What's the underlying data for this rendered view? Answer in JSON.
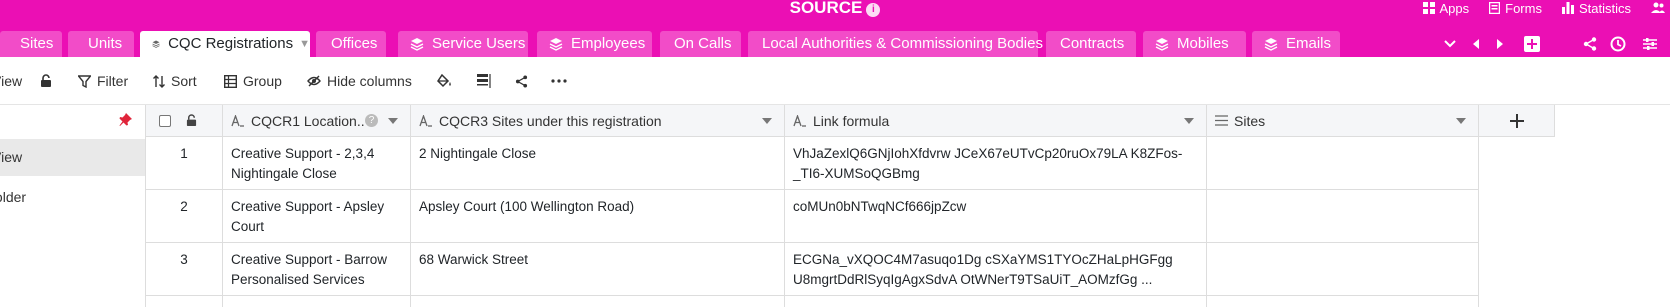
{
  "header": {
    "title": "SOURCE",
    "links": [
      {
        "label": "Apps",
        "icon": "apps-icon"
      },
      {
        "label": "Forms",
        "icon": "forms-icon"
      },
      {
        "label": "Statistics",
        "icon": "statistics-icon"
      }
    ]
  },
  "tabs": [
    {
      "label": "Sites",
      "icon": ""
    },
    {
      "label": "Units",
      "icon": ""
    },
    {
      "label": "CQC Registrations",
      "icon": "layers-icon",
      "active": true
    },
    {
      "label": "Offices",
      "icon": ""
    },
    {
      "label": "Service Users",
      "icon": "layers-icon"
    },
    {
      "label": "Employees",
      "icon": "layers-icon"
    },
    {
      "label": "On Calls",
      "icon": ""
    },
    {
      "label": "Local Authorities & Commissioning Bodies",
      "icon": ""
    },
    {
      "label": "Contracts",
      "icon": ""
    },
    {
      "label": "Mobiles",
      "icon": "layers-icon"
    },
    {
      "label": "Emails",
      "icon": "layers-icon"
    }
  ],
  "toolbar": {
    "view_label": "View",
    "filter_label": "Filter",
    "sort_label": "Sort",
    "group_label": "Group",
    "hide_columns_label": "Hide columns"
  },
  "sidebar": {
    "items": [
      {
        "label": "View",
        "active": true
      },
      {
        "label": "Add view or folder",
        "active": false
      }
    ]
  },
  "table": {
    "columns": [
      {
        "label": "CQCR1 Location...",
        "icon": "text-icon"
      },
      {
        "label": "CQCR3 Sites under this registration",
        "icon": "text-icon"
      },
      {
        "label": "Link formula",
        "icon": "formula-icon"
      },
      {
        "label": "Sites",
        "icon": "link-icon"
      }
    ],
    "rows": [
      {
        "num": "1",
        "location": "Creative Support - 2,3,4 Nightingale Close",
        "sites_under": "2 Nightingale Close",
        "link_formula": "VhJaZexlQ6GNjIohXfdvrw JCeX67eUTvCp20ruOx79LA K8ZFos-_TI6-XUMSoQGBmg",
        "sites": ""
      },
      {
        "num": "2",
        "location": "Creative Support - Apsley Court",
        "sites_under": "Apsley Court (100 Wellington Road)",
        "link_formula": "coMUn0bNTwqNCf666jpZcw",
        "sites": ""
      },
      {
        "num": "3",
        "location": "Creative Support - Barrow Personalised Services",
        "sites_under": "68 Warwick Street",
        "link_formula": "ECGNa_vXQOC4M7asuqo1Dg cSXaYMS1TYOcZHaLpHGFgg U8mgrtDdRlSyqIgAgxSdvA OtWNerT9TSaUiT_AOMzfGg ...",
        "sites": ""
      }
    ]
  },
  "colors": {
    "brand": "#EB0FB4",
    "tab_inactive": "#F24CC8",
    "pin": "#e0243a"
  }
}
